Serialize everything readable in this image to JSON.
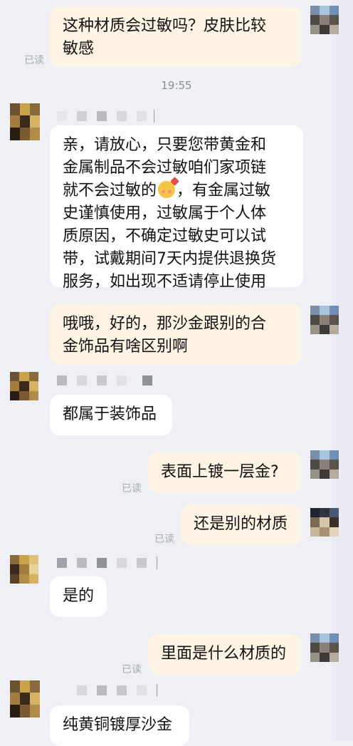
{
  "chat": {
    "read_label": "已读",
    "timestamp": "19:55",
    "messages": [
      {
        "side": "out",
        "text": "这种材质会过敏吗？皮肤比较\n敏感",
        "read": true
      },
      {
        "side": "in",
        "text_a": "亲，请放心，只要您带黄金和\n金属制品不会过敏咱们家项链\n就不会过敏的",
        "emoji": "blushing-face-with-heart-emoji",
        "text_b": "，有金属过敏\n史谨慎使用，过敏属于个人体\n质原因，不确定过敏史可以试\n带，试戴期间7天内提供退换货\n服务，如出现不适请停止使用"
      },
      {
        "side": "out",
        "text": "哦哦，好的，那沙金跟别的合\n金饰品有啥区别啊"
      },
      {
        "side": "in",
        "text": "都属于装饰品"
      },
      {
        "side": "out",
        "text": "表面上镀一层金?",
        "read": true
      },
      {
        "side": "out",
        "text": "还是别的材质",
        "read": true
      },
      {
        "side": "in",
        "text": "是的"
      },
      {
        "side": "out",
        "text": "里面是什么材质的",
        "read": true
      },
      {
        "side": "in",
        "text": "纯黄铜镀厚沙金"
      }
    ]
  },
  "colors": {
    "background": "#eef0f6",
    "outgoing_bubble": "#fff4e3",
    "incoming_bubble": "#ffffff",
    "read_text": "#a5a8b0"
  }
}
